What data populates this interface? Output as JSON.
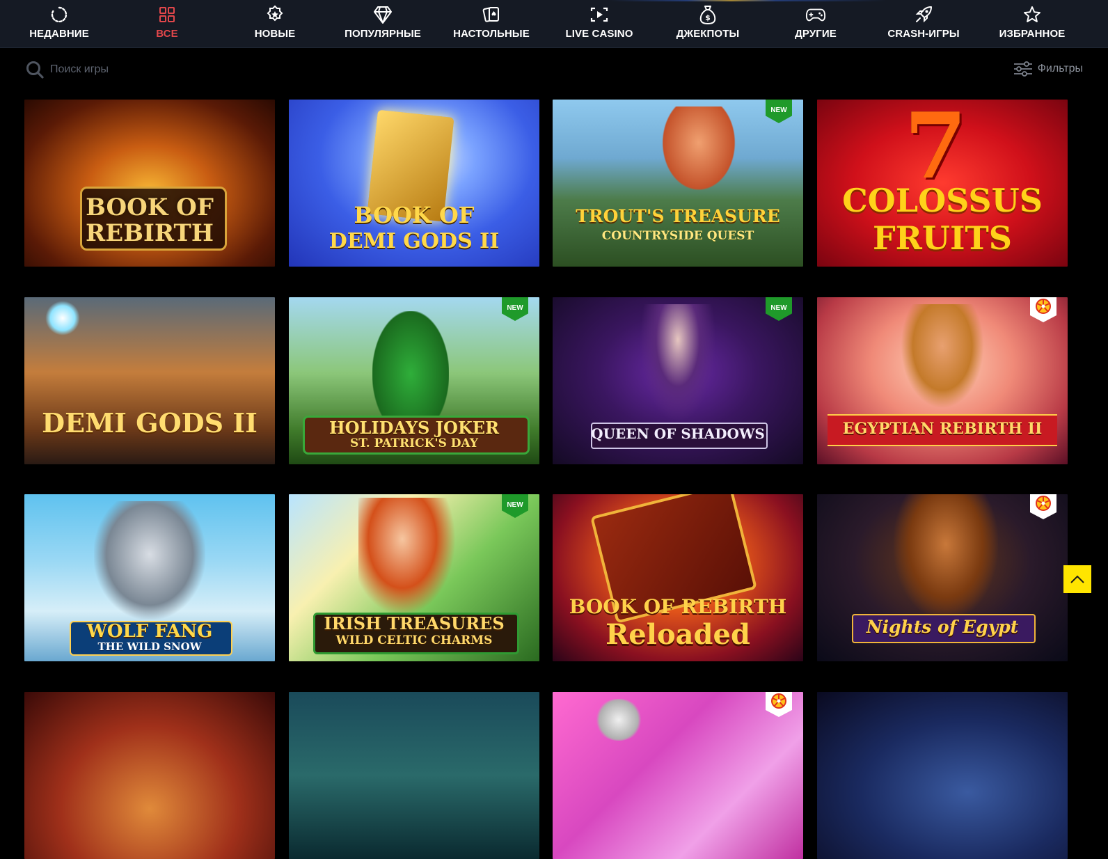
{
  "nav": {
    "categories": [
      {
        "label": "НЕДАВНИЕ",
        "icon": "recent-icon",
        "active": false
      },
      {
        "label": "ВСЕ",
        "icon": "grid-icon",
        "active": true
      },
      {
        "label": "НОВЫЕ",
        "icon": "new-badge-icon",
        "active": false
      },
      {
        "label": "ПОПУЛЯРНЫЕ",
        "icon": "diamond-icon",
        "active": false
      },
      {
        "label": "НАСТОЛЬНЫЕ",
        "icon": "cards-icon",
        "active": false
      },
      {
        "label": "LIVE CASINO",
        "icon": "live-screen-icon",
        "active": false
      },
      {
        "label": "ДЖЕКПОТЫ",
        "icon": "money-bag-icon",
        "active": false
      },
      {
        "label": "ДРУГИЕ",
        "icon": "gamepad-icon",
        "active": false
      },
      {
        "label": "CRASH-ИГРЫ",
        "icon": "rocket-icon",
        "active": false
      },
      {
        "label": "ИЗБРАННОЕ",
        "icon": "star-icon",
        "active": false
      }
    ],
    "active_color": "#e2474b"
  },
  "search": {
    "placeholder": "Поиск игры",
    "value": ""
  },
  "filters": {
    "label": "Фильтры"
  },
  "badges": {
    "new_label": "NEW"
  },
  "games": [
    {
      "title": "BOOK OF",
      "subtitle": "REBIRTH",
      "badge": null
    },
    {
      "title": "BOOK OF",
      "subtitle": "DEMI GODS II",
      "badge": null
    },
    {
      "title": "TROUT'S TREASURE",
      "subtitle": "COUNTRYSIDE QUEST",
      "badge": "new"
    },
    {
      "title": "COLOSSUS",
      "subtitle": "FRUITS",
      "badge": null
    },
    {
      "title": "DEMI GODS II",
      "subtitle": "",
      "badge": null
    },
    {
      "title": "HOLIDAYS JOKER",
      "subtitle": "ST. PATRICK'S DAY",
      "badge": "new"
    },
    {
      "title": "QUEEN OF SHADOWS",
      "subtitle": "",
      "badge": "new"
    },
    {
      "title": "EGYPTIAN REBIRTH II",
      "subtitle": "",
      "badge": "wheel"
    },
    {
      "title": "WOLF FANG",
      "subtitle": "THE WILD SNOW",
      "badge": null
    },
    {
      "title": "IRISH TREASURES",
      "subtitle": "WILD CELTIC CHARMS",
      "badge": "new"
    },
    {
      "title": "BOOK OF REBIRTH",
      "subtitle": "Reloaded",
      "badge": null
    },
    {
      "title": "Nights of Egypt",
      "subtitle": "",
      "badge": "wheel"
    },
    {
      "title": "",
      "subtitle": "",
      "badge": null
    },
    {
      "title": "",
      "subtitle": "",
      "badge": null
    },
    {
      "title": "",
      "subtitle": "",
      "badge": "wheel"
    },
    {
      "title": "",
      "subtitle": "",
      "badge": null
    }
  ]
}
